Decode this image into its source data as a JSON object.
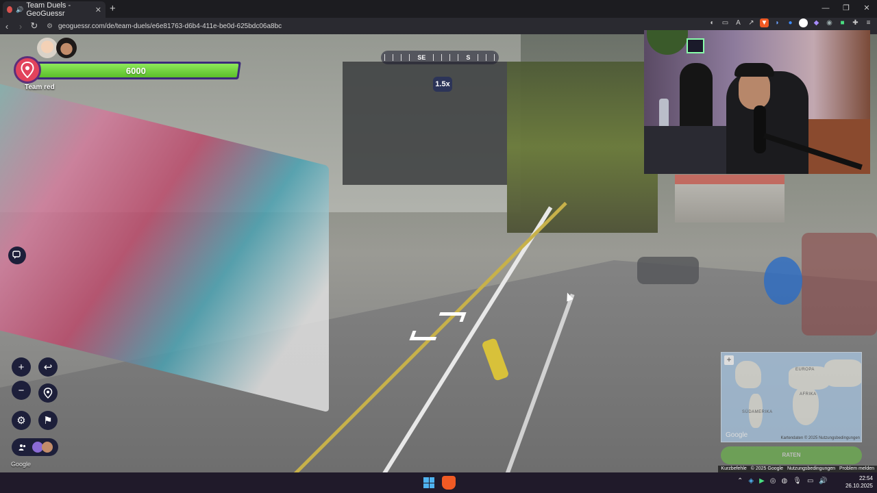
{
  "browser": {
    "tab_title": "Team Duels - GeoGuessr",
    "tab_close": "✕",
    "new_tab": "+",
    "url": "geoguessr.com/de/team-duels/e6e81763-d6b4-411e-be0d-625bdc06a8bc",
    "window_controls": [
      "—",
      "❐",
      "✕"
    ]
  },
  "game": {
    "team_name": "Team red",
    "health": "6000",
    "health_fraction": 1.0,
    "compass": [
      "|",
      "|",
      "|",
      "|",
      "SE",
      "|",
      "|",
      "|",
      "|",
      "S",
      "|",
      "|",
      "|"
    ],
    "zoom_level": "1.5x"
  },
  "controls": {
    "zoom_in": "+",
    "zoom_out": "−",
    "undo": "↩",
    "settings": "⚙",
    "flag": "⚑"
  },
  "watermark": "Google",
  "minimap": {
    "labels": [
      "AFRIKA",
      "SÜDAMERIKA",
      "EUROPA"
    ],
    "google": "Google",
    "footer": "Kartendaten © 2025  Nutzungsbedingungen",
    "zoom_in": "+",
    "guess_button": "RATEN"
  },
  "attribution": [
    "Kurzbefehle",
    "© 2025 Google",
    "Nutzungsbedingungen",
    "Problem melden"
  ],
  "taskbar": {
    "time": "22:54",
    "date": "26.10.2025",
    "tray_icons": [
      "chevron-up-icon",
      "network-icon",
      "play-icon",
      "discord-icon",
      "chrome-icon",
      "mic-icon",
      "screen-icon",
      "volume-icon"
    ]
  },
  "colors": {
    "health_green": "#6cc744",
    "team_red": "#e2435c",
    "ui_navy": "#1d1f3a"
  }
}
